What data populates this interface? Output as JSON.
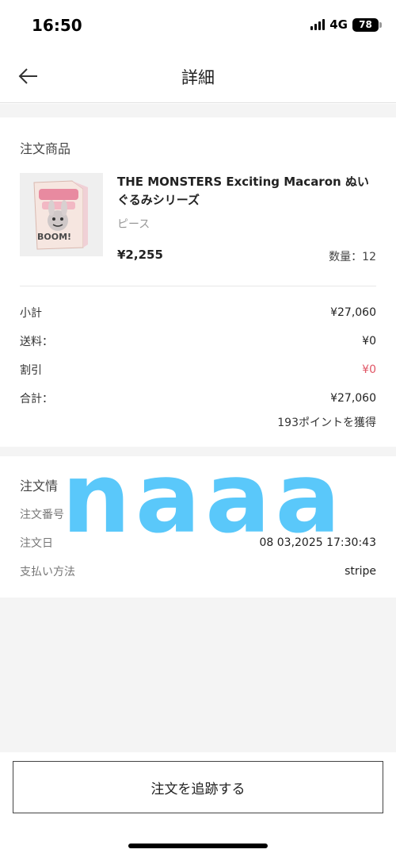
{
  "status_bar": {
    "time": "16:50",
    "network": "4G",
    "battery": "78"
  },
  "header": {
    "back_icon": "arrow-left-icon",
    "title": "詳細"
  },
  "order_items": {
    "section_title": "注文商品",
    "product": {
      "name": "THE MONSTERS Exciting Macaron ぬいぐるみシリーズ",
      "variant": "ピース",
      "price": "¥2,255",
      "quantity": "数量：12",
      "thumb_text": "BOOM!"
    }
  },
  "summary": {
    "subtotal_label": "小計",
    "subtotal_value": "¥27,060",
    "shipping_label": "送料：",
    "shipping_value": "¥0",
    "discount_label": "割引",
    "discount_value": "¥0",
    "total_label": "合計：",
    "total_value": "¥27,060",
    "points": "193ポイントを獲得",
    "discount_color": "#e05565"
  },
  "order_info": {
    "section_title": "注文情",
    "order_no_label": "注文番号",
    "order_date_label": "注文日",
    "order_date_value": "08 03,2025 17:30:43",
    "payment_label": "支払い方法",
    "payment_value": "stripe"
  },
  "watermark": {
    "text": "naaa",
    "color": "#5ac8fa"
  },
  "footer": {
    "track_button": "注文を追跡する"
  }
}
